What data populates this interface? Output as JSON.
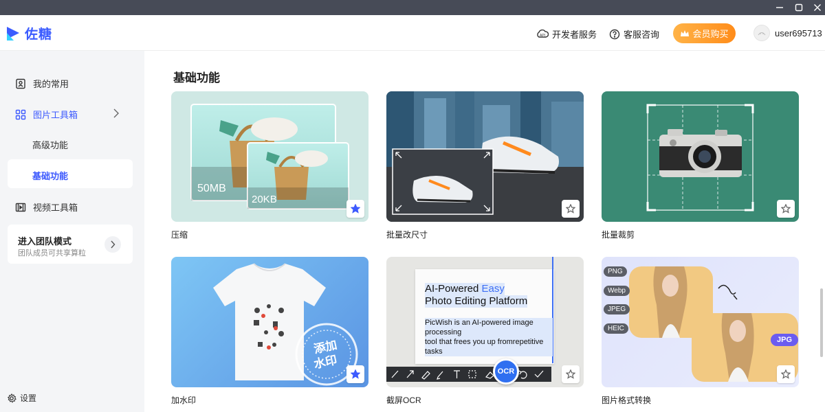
{
  "app": {
    "name": "佐糖"
  },
  "header": {
    "dev_service": "开发者服务",
    "support": "客服咨询",
    "vip": "会员购买",
    "username": "user695713"
  },
  "sidebar": {
    "items": [
      {
        "label": "我的常用"
      },
      {
        "label": "图片工具箱"
      },
      {
        "label": "高级功能"
      },
      {
        "label": "基础功能"
      },
      {
        "label": "视频工具箱"
      }
    ],
    "team": {
      "title": "进入团队模式",
      "subtitle": "团队成员可共享算粒"
    },
    "settings": "设置"
  },
  "main": {
    "section_title": "基础功能",
    "cards": [
      {
        "label": "压缩",
        "size_before": "50MB",
        "size_after": "20KB",
        "starred": true
      },
      {
        "label": "批量改尺寸",
        "starred": false
      },
      {
        "label": "批量裁剪",
        "starred": false
      },
      {
        "label": "加水印",
        "watermark_text_1": "添加",
        "watermark_text_2": "水印",
        "starred": true
      },
      {
        "label": "截屏OCR",
        "ocr_line1a": "AI-Powered ",
        "ocr_line1b": "Easy",
        "ocr_line2": "Photo Editing Platform",
        "ocr_body1": "PicWish is an AI-powered image processing",
        "ocr_body2": "tool that frees you up fromrepetitive tasks",
        "ocr_badge": "OCR",
        "starred": false
      },
      {
        "label": "图片格式转换",
        "formats": [
          "PNG",
          "Webp",
          "JPEG",
          "HEIC"
        ],
        "target_format": "JPG",
        "starred": false
      }
    ]
  }
}
